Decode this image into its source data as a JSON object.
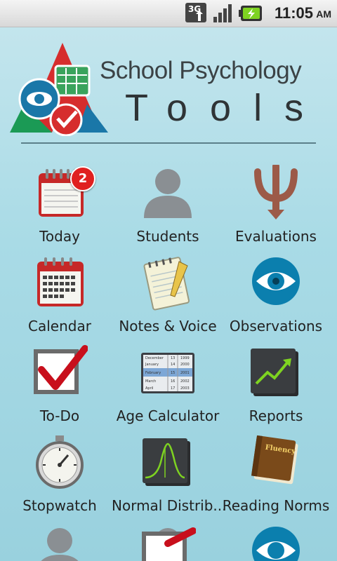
{
  "status_bar": {
    "network": "3G",
    "time": "11:05",
    "ampm": "AM"
  },
  "header": {
    "title_line1": "School Psychology",
    "title_line2": "Tools"
  },
  "grid": {
    "items": [
      {
        "label": "Today",
        "icon": "calendar-today-icon",
        "badge": "2"
      },
      {
        "label": "Students",
        "icon": "person-silhouette-icon"
      },
      {
        "label": "Evaluations",
        "icon": "psi-icon"
      },
      {
        "label": "Calendar",
        "icon": "calendar-month-icon"
      },
      {
        "label": "Notes & Voice",
        "icon": "notepad-icon"
      },
      {
        "label": "Observations",
        "icon": "eye-icon"
      },
      {
        "label": "To-Do",
        "icon": "checkbox-icon"
      },
      {
        "label": "Age Calculator",
        "icon": "date-picker-icon"
      },
      {
        "label": "Reports",
        "icon": "chart-up-icon"
      },
      {
        "label": "Stopwatch",
        "icon": "stopwatch-icon"
      },
      {
        "label": "Normal Distrib...",
        "icon": "bell-curve-icon"
      },
      {
        "label": "Reading Norms",
        "icon": "fluency-book-icon"
      }
    ],
    "age_calc_rows": [
      {
        "month": "December",
        "day": "13",
        "year": "1999"
      },
      {
        "month": "January",
        "day": "14",
        "year": "2000"
      },
      {
        "month": "February",
        "day": "15",
        "year": "2001"
      },
      {
        "month": "March",
        "day": "16",
        "year": "2002"
      },
      {
        "month": "April",
        "day": "17",
        "year": "2003"
      }
    ],
    "book_title": "Fluency",
    "calendar_days": [
      "1",
      "2",
      "3",
      "4",
      "5",
      "6",
      "7",
      "8",
      "9",
      "10",
      "11",
      "12",
      "13",
      "14",
      "15",
      "16",
      "17",
      "18",
      "19",
      "20",
      "21",
      "22",
      "23",
      "24",
      "25",
      "26",
      "27",
      "28"
    ]
  }
}
